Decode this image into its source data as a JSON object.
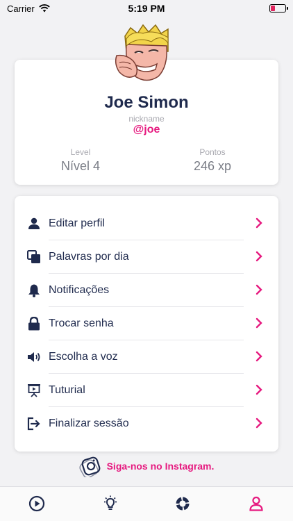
{
  "status_bar": {
    "carrier": "Carrier",
    "time": "5:19 PM"
  },
  "profile": {
    "name": "Joe Simon",
    "nickname_label": "nickname",
    "nickname": "@joe",
    "level_label": "Level",
    "level_value": "Nível 4",
    "points_label": "Pontos",
    "points_value": "246 xp"
  },
  "menu": [
    {
      "label": "Editar perfil",
      "icon": "user-icon"
    },
    {
      "label": "Palavras por dia",
      "icon": "copy-icon"
    },
    {
      "label": "Notificações",
      "icon": "bell-icon"
    },
    {
      "label": "Trocar senha",
      "icon": "lock-icon"
    },
    {
      "label": "Escolha a voz",
      "icon": "speaker-icon"
    },
    {
      "label": "Tuturial",
      "icon": "presentation-icon"
    },
    {
      "label": "Finalizar sessão",
      "icon": "logout-icon"
    }
  ],
  "instagram": {
    "label": "Siga-nos no Instagram."
  },
  "tabbar": {
    "items": [
      "play-icon",
      "lightbulb-icon",
      "stats-icon",
      "profile-icon"
    ],
    "active": "profile-icon"
  },
  "colors": {
    "accent": "#e6197f",
    "primary_text": "#1f2a4d",
    "muted": "#a9a9b0",
    "battery_low": "#e0245e"
  }
}
